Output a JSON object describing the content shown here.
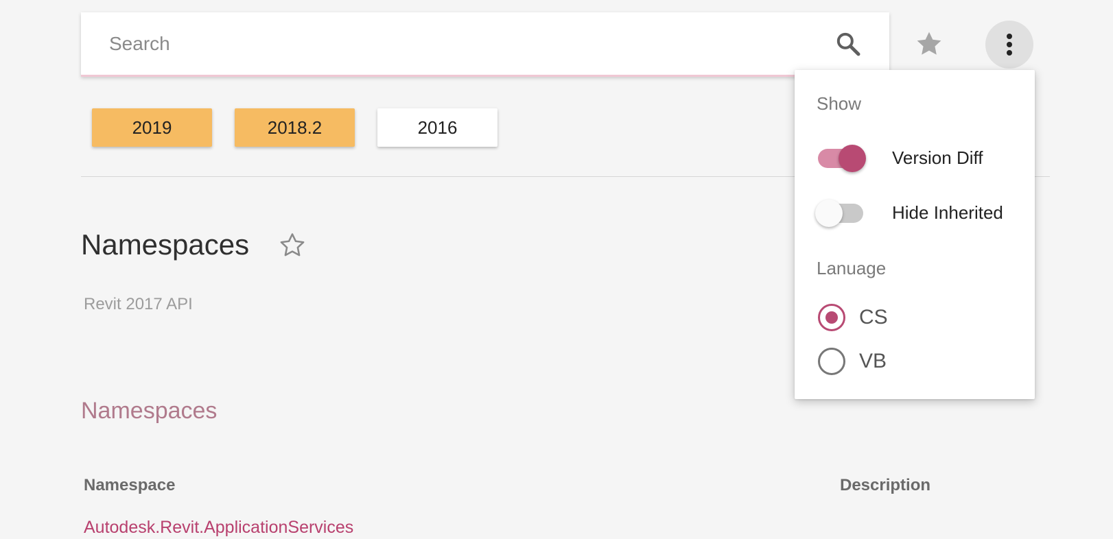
{
  "search": {
    "placeholder": "Search",
    "value": ""
  },
  "toolbar": {
    "favorites_icon": "star-filled-icon",
    "more_icon": "more-vert-icon"
  },
  "versions": [
    {
      "label": "2019",
      "active": true
    },
    {
      "label": "2018.2",
      "active": true
    },
    {
      "label": "2016",
      "active": false
    }
  ],
  "page": {
    "title": "Namespaces",
    "subtitle": "Revit 2017 API",
    "section_heading": "Namespaces"
  },
  "table": {
    "columns": [
      "Namespace",
      "Description"
    ],
    "rows": [
      {
        "namespace": "Autodesk.Revit.ApplicationServices",
        "description": ""
      }
    ]
  },
  "menu": {
    "show_label": "Show",
    "toggles": [
      {
        "label": "Version Diff",
        "on": true
      },
      {
        "label": "Hide Inherited",
        "on": false
      }
    ],
    "language_label": "Lanuage",
    "languages": [
      {
        "label": "CS",
        "selected": true
      },
      {
        "label": "VB",
        "selected": false
      }
    ]
  },
  "colors": {
    "accent": "#b84a73",
    "chip_active": "#f6bb62",
    "section_heading": "#b07a8c",
    "background": "#f5f5f5"
  }
}
